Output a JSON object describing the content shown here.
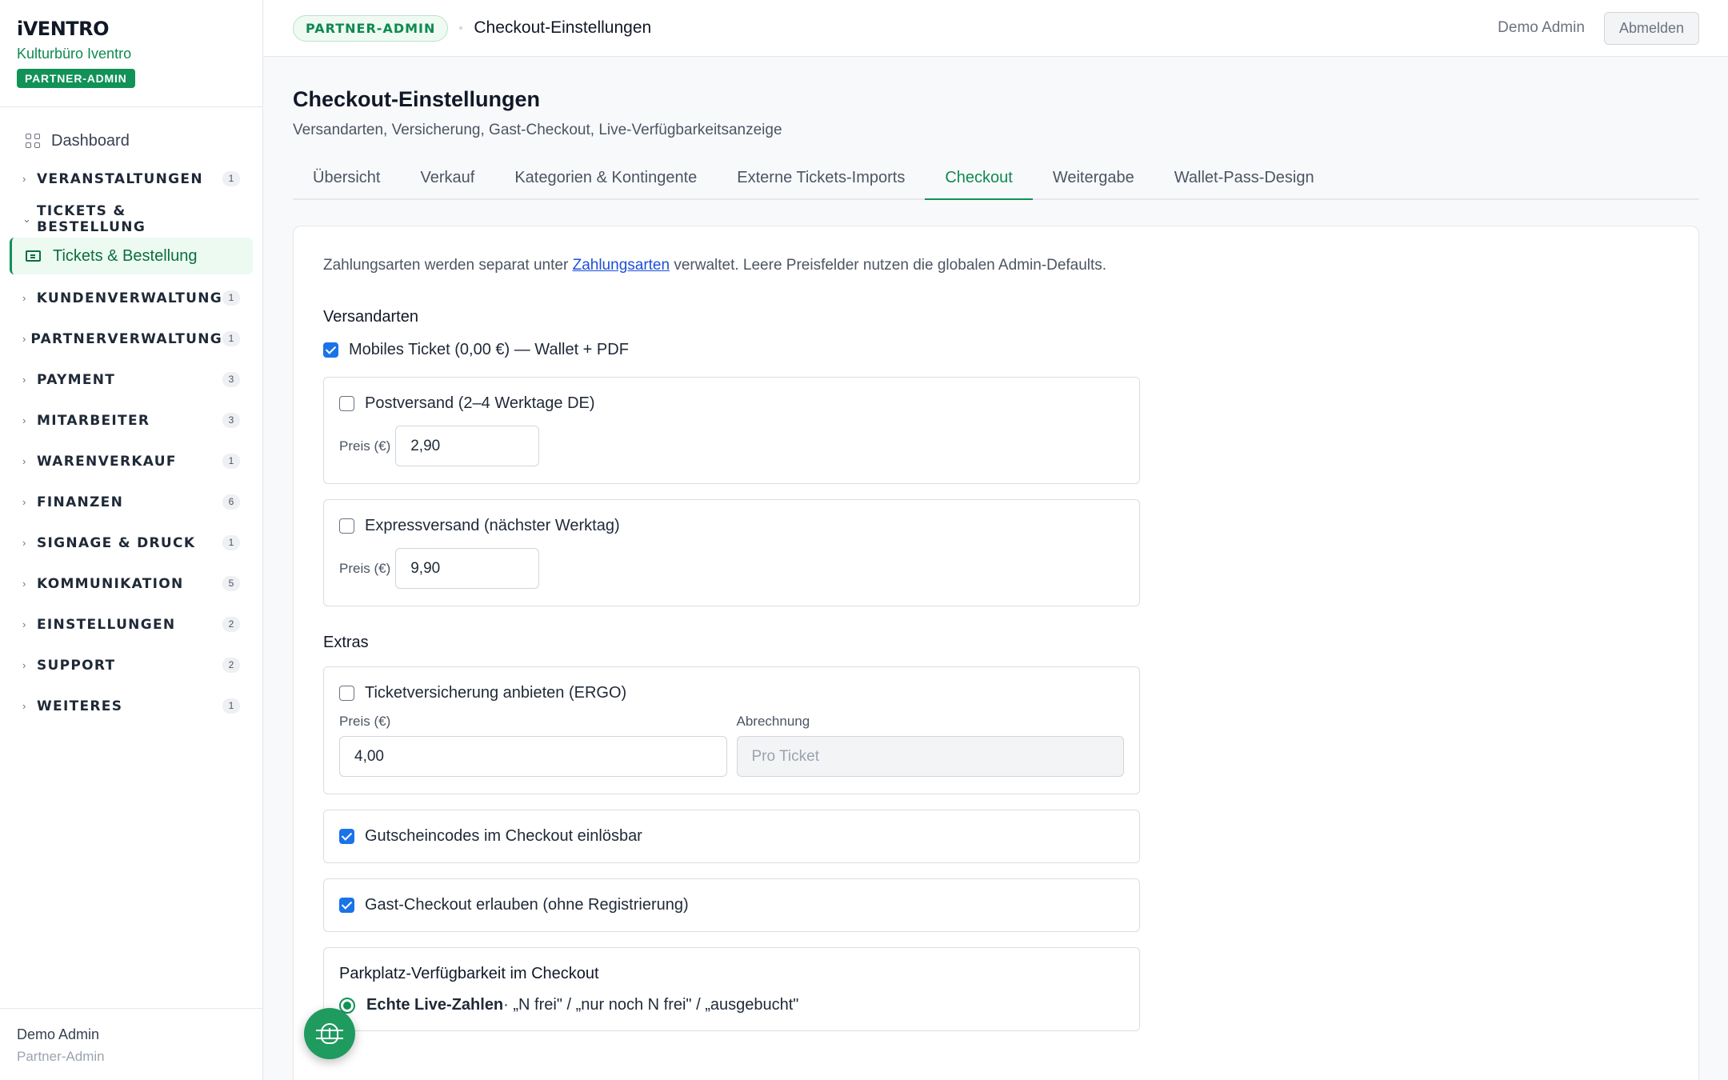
{
  "brand": {
    "logo": "iVENTRO",
    "org": "Kulturbüro Iventro",
    "badge": "PARTNER-ADMIN"
  },
  "sidebar": {
    "dashboard": "Dashboard",
    "groups": [
      {
        "label": "VERANSTALTUNGEN",
        "count": "1"
      },
      {
        "label": "TICKETS & BESTELLUNG",
        "count": ""
      },
      {
        "label": "KUNDENVERWALTUNG",
        "count": "1"
      },
      {
        "label": "PARTNERVERWALTUNG",
        "count": "1"
      },
      {
        "label": "PAYMENT",
        "count": "3"
      },
      {
        "label": "MITARBEITER",
        "count": "3"
      },
      {
        "label": "WARENVERKAUF",
        "count": "1"
      },
      {
        "label": "FINANZEN",
        "count": "6"
      },
      {
        "label": "SIGNAGE & DRUCK",
        "count": "1"
      },
      {
        "label": "KOMMUNIKATION",
        "count": "5"
      },
      {
        "label": "EINSTELLUNGEN",
        "count": "2"
      },
      {
        "label": "SUPPORT",
        "count": "2"
      },
      {
        "label": "WEITERES",
        "count": "1"
      }
    ],
    "active_item": "Tickets & Bestellung",
    "footer": {
      "name": "Demo Admin",
      "role": "Partner-Admin"
    }
  },
  "topbar": {
    "badge": "PARTNER-ADMIN",
    "title": "Checkout-Einstellungen",
    "user": "Demo Admin",
    "logout": "Abmelden"
  },
  "page": {
    "title": "Checkout-Einstellungen",
    "subtitle": "Versandarten, Versicherung, Gast-Checkout, Live-Verfügbarkeitsanzeige",
    "tabs": [
      "Übersicht",
      "Verkauf",
      "Kategorien & Kontingente",
      "Externe Tickets-Imports",
      "Checkout",
      "Weitergabe",
      "Wallet-Pass-Design"
    ],
    "active_tab": "Checkout"
  },
  "card": {
    "info_before": "Zahlungsarten werden separat unter ",
    "info_link": "Zahlungsarten",
    "info_after": " verwaltet. Leere Preisfelder nutzen die globalen Admin-Defaults.",
    "shipping": {
      "title": "Versandarten",
      "mobile": {
        "label": "Mobiles Ticket (0,00 €) — Wallet + PDF",
        "checked": true
      },
      "post": {
        "label": "Postversand (2–4 Werktage DE)",
        "checked": false,
        "price_label": "Preis (€)",
        "price": "2,90"
      },
      "express": {
        "label": "Expressversand (nächster Werktag)",
        "checked": false,
        "price_label": "Preis (€)",
        "price": "9,90"
      }
    },
    "extras": {
      "title": "Extras",
      "insurance": {
        "label": "Ticketversicherung anbieten (ERGO)",
        "checked": false,
        "price_label": "Preis (€)",
        "price": "4,00",
        "billing_label": "Abrechnung",
        "billing_placeholder": "Pro Ticket"
      },
      "voucher": {
        "label": "Gutscheincodes im Checkout einlösbar",
        "checked": true
      },
      "guest": {
        "label": "Gast-Checkout erlauben (ohne Registrierung)",
        "checked": true
      }
    },
    "parking": {
      "title": "Parkplatz-Verfügbarkeit im Checkout",
      "option_bold": "Echte Live-Zahlen",
      "option_rest": " · „N frei\" / „nur noch N frei\" / „ausgebucht\""
    }
  }
}
